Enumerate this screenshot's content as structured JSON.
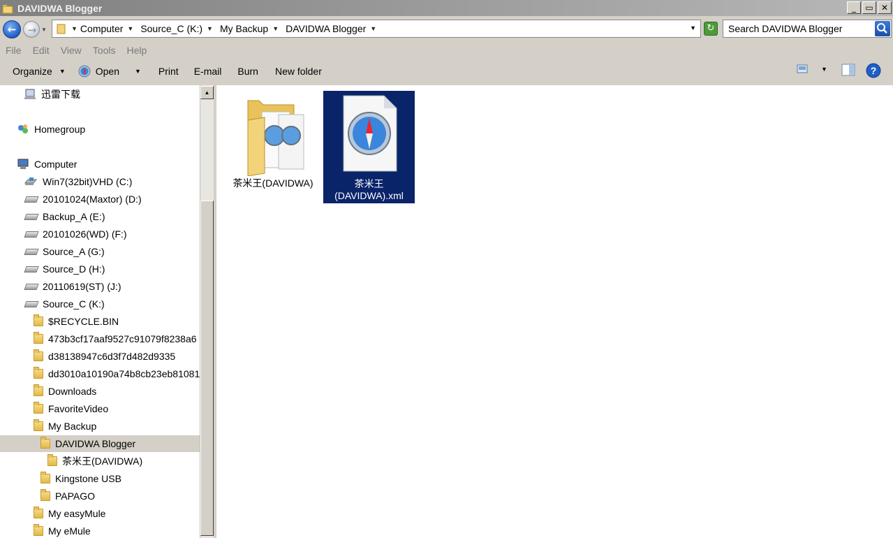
{
  "window": {
    "title": "DAVIDWA Blogger",
    "controls": [
      "_",
      "▭",
      "✕"
    ]
  },
  "address": {
    "crumbs": [
      "Computer",
      "Source_C (K:)",
      "My Backup",
      "DAVIDWA Blogger"
    ]
  },
  "search": {
    "placeholder": "Search DAVIDWA Blogger"
  },
  "menu": [
    "File",
    "Edit",
    "View",
    "Tools",
    "Help"
  ],
  "toolbar": {
    "organize": "Organize",
    "open": "Open",
    "print": "Print",
    "email": "E-mail",
    "burn": "Burn",
    "new_folder": "New folder"
  },
  "nav": {
    "items": [
      {
        "label": "迅雷下载",
        "icon": "network-drive-icon"
      },
      {
        "label": "Homegroup",
        "icon": "homegroup-icon"
      },
      {
        "label": "Computer",
        "icon": "computer-icon"
      },
      {
        "label": "Win7(32bit)VHD (C:)",
        "icon": "os-drive-icon"
      },
      {
        "label": "20101024(Maxtor) (D:)",
        "icon": "drive-icon"
      },
      {
        "label": "Backup_A (E:)",
        "icon": "drive-icon"
      },
      {
        "label": "20101026(WD) (F:)",
        "icon": "drive-icon"
      },
      {
        "label": "Source_A (G:)",
        "icon": "drive-icon"
      },
      {
        "label": "Source_D (H:)",
        "icon": "drive-icon"
      },
      {
        "label": "20110619(ST) (J:)",
        "icon": "drive-icon"
      },
      {
        "label": "Source_C (K:)",
        "icon": "drive-icon"
      },
      {
        "label": "$RECYCLE.BIN",
        "icon": "folder-icon"
      },
      {
        "label": "473b3cf17aaf9527c91079f8238a6",
        "icon": "folder-icon"
      },
      {
        "label": "d38138947c6d3f7d482d9335",
        "icon": "folder-icon"
      },
      {
        "label": "dd3010a10190a74b8cb23eb81081",
        "icon": "folder-icon"
      },
      {
        "label": "Downloads",
        "icon": "folder-icon"
      },
      {
        "label": "FavoriteVideo",
        "icon": "folder-icon"
      },
      {
        "label": "My Backup",
        "icon": "folder-icon"
      },
      {
        "label": "DAVIDWA Blogger",
        "icon": "folder-icon"
      },
      {
        "label": "茶米王(DAVIDWA)",
        "icon": "folder-icon"
      },
      {
        "label": "Kingstone USB",
        "icon": "folder-icon"
      },
      {
        "label": "PAPAGO",
        "icon": "folder-icon"
      },
      {
        "label": "My easyMule",
        "icon": "folder-icon"
      },
      {
        "label": "My eMule",
        "icon": "folder-icon"
      }
    ]
  },
  "files": [
    {
      "line1": "茶米王(DAVIDWA)",
      "line2": "",
      "type": "folder"
    },
    {
      "line1": "茶米王",
      "line2": "(DAVIDWA).xml",
      "type": "xml-file"
    }
  ],
  "colors": {
    "selection": "#0a246a",
    "chrome": "#d4d0c8",
    "titlebar": "#808080"
  }
}
